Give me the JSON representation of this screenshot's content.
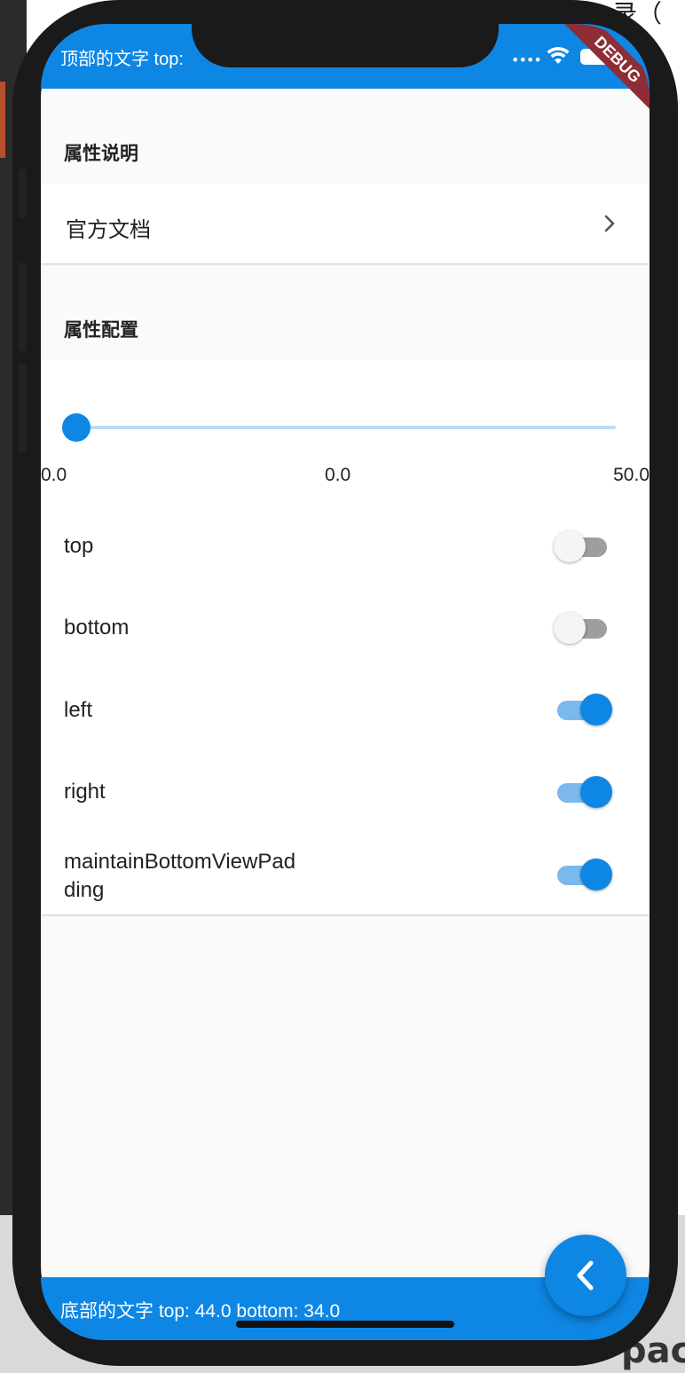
{
  "colors": {
    "primary": "#0e86e4",
    "page_bg": "#fafafa",
    "card_bg": "#ffffff",
    "debug_ribbon": "#8e2d36"
  },
  "status_bar": {
    "top_text": "顶部的文字 top:",
    "signal_icon": "signal-dots-icon",
    "wifi_icon": "wifi-icon",
    "battery_icon": "battery-icon"
  },
  "debug_banner": {
    "label": "DEBUG"
  },
  "sections": {
    "description_title": "属性说明",
    "config_title": "属性配置"
  },
  "doc_link": {
    "label": "官方文档",
    "icon": "chevron-right-icon"
  },
  "slider": {
    "min_label": "0.0",
    "value_label": "0.0",
    "max_label": "50.0",
    "value": 0.0,
    "min": 0.0,
    "max": 50.0
  },
  "toggles": [
    {
      "label": "top",
      "on": false
    },
    {
      "label": "bottom",
      "on": false
    },
    {
      "label": "left",
      "on": true
    },
    {
      "label": "right",
      "on": true
    },
    {
      "label_line1": "maintainBottomViewPad",
      "label_line2": "ding",
      "on": true
    }
  ],
  "bottom_bar": {
    "text": "底部的文字 top: 44.0 bottom: 34.0"
  },
  "fab": {
    "icon": "back-arrow-icon"
  },
  "background": {
    "fragment_1": "录（",
    "fragment_2": "pac"
  }
}
